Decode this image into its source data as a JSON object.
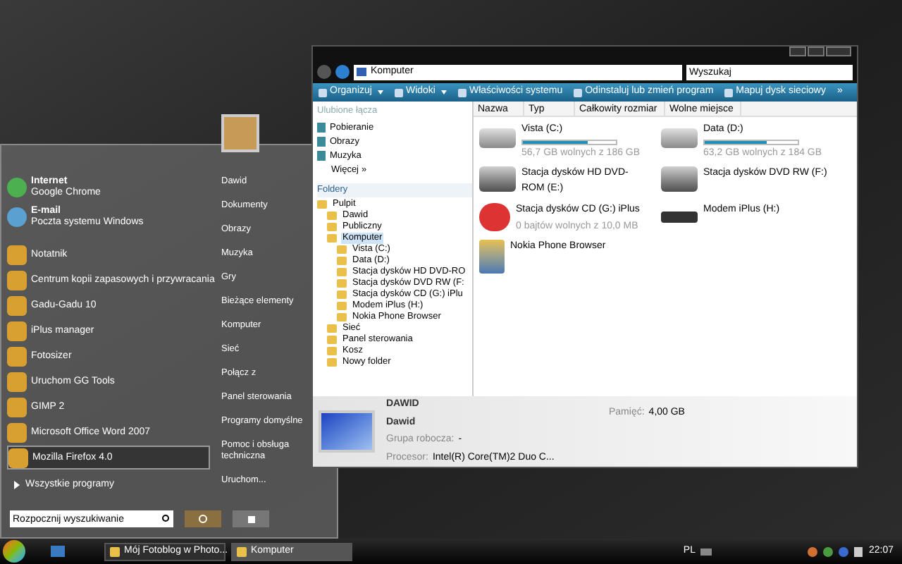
{
  "start_menu": {
    "pinned": [
      {
        "title": "Internet",
        "subtitle": "Google Chrome",
        "selected": false
      },
      {
        "title": "E-mail",
        "subtitle": "Poczta systemu Windows",
        "selected": false
      }
    ],
    "recent": [
      {
        "label": "Notatnik",
        "selected": false
      },
      {
        "label": "Centrum kopii zapasowych i przywracania",
        "selected": false
      },
      {
        "label": "Gadu-Gadu 10",
        "selected": false
      },
      {
        "label": "iPlus manager",
        "selected": false
      },
      {
        "label": "Fotosizer",
        "selected": false
      },
      {
        "label": "Uruchom GG Tools",
        "selected": false
      },
      {
        "label": "GIMP 2",
        "selected": false
      },
      {
        "label": "Microsoft Office Word 2007",
        "selected": false
      },
      {
        "label": "Mozilla Firefox 4.0",
        "selected": true
      }
    ],
    "all_programs": "Wszystkie programy",
    "search": {
      "placeholder": "Rozpocznij wyszukiwanie"
    },
    "places": [
      "Dawid",
      "Dokumenty",
      "Obrazy",
      "Muzyka",
      "Gry",
      "Bieżące elementy",
      "Komputer",
      "Sieć",
      "Połącz z",
      "Panel sterowania",
      "Programy domyślne",
      "Pomoc i obsługa techniczna",
      "Uruchom..."
    ]
  },
  "explorer": {
    "address": "Komputer",
    "search": {
      "placeholder": "Wyszukaj"
    },
    "toolbar": [
      {
        "label": "Organizuj",
        "dropdown": true
      },
      {
        "label": "Widoki",
        "dropdown": true
      },
      {
        "label": "Właściwości systemu",
        "dropdown": false
      },
      {
        "label": "Odinstaluj lub zmień program",
        "dropdown": false
      },
      {
        "label": "Mapuj dysk sieciowy",
        "dropdown": false
      }
    ],
    "toolbar_more": "»",
    "favorites_title": "Ulubione łącza",
    "favorites": [
      "Pobieranie",
      "Obrazy",
      "Muzyka"
    ],
    "favorites_more": "Więcej",
    "favorites_more_glyph": "»",
    "folders_title": "Foldery",
    "tree": [
      {
        "label": "Pulpit",
        "selected": false,
        "children": [
          {
            "label": "Dawid",
            "selected": false
          },
          {
            "label": "Publiczny",
            "selected": false
          },
          {
            "label": "Komputer",
            "selected": true,
            "children": [
              {
                "label": "Vista (C:)",
                "selected": false
              },
              {
                "label": "Data (D:)",
                "selected": false
              },
              {
                "label": "Stacja dysków HD DVD-RO",
                "selected": false
              },
              {
                "label": "Stacja dysków DVD RW (F:",
                "selected": false
              },
              {
                "label": "Stacja dysków CD (G:) iPlu",
                "selected": false
              },
              {
                "label": "Modem iPlus (H:)",
                "selected": false
              },
              {
                "label": "Nokia Phone Browser",
                "selected": false
              }
            ]
          },
          {
            "label": "Sieć",
            "selected": false
          },
          {
            "label": "Panel sterowania",
            "selected": false
          },
          {
            "label": "Kosz",
            "selected": false
          },
          {
            "label": "Nowy folder",
            "selected": false
          }
        ]
      }
    ],
    "columns": [
      "Nazwa",
      "Typ",
      "Całkowity rozmiar",
      "Wolne miejsce"
    ],
    "items": [
      {
        "kind": "disk",
        "name": "Vista (C:)",
        "level": 0.7,
        "free": "56,7 GB wolnych z 186 GB"
      },
      {
        "kind": "disk",
        "name": "Data (D:)",
        "level": 0.66,
        "free": "63,2 GB wolnych z 184 GB"
      },
      {
        "kind": "dvd",
        "name": "Stacja dysków HD DVD-ROM (E:)"
      },
      {
        "kind": "dvd",
        "name": "Stacja dysków DVD RW (F:)"
      },
      {
        "kind": "cd",
        "name": "Stacja dysków CD (G:) iPlus",
        "free": "0 bajtów wolnych z 10,0 MB"
      },
      {
        "kind": "modem",
        "name": "Modem iPlus (H:)"
      },
      {
        "kind": "app",
        "name": "Nokia Phone Browser"
      }
    ],
    "details": {
      "name": "DAWID",
      "user": "Dawid",
      "fields": [
        {
          "label": "Grupa robocza:",
          "value": "-"
        },
        {
          "label": "Procesor:",
          "value": "Intel(R) Core(TM)2 Duo C..."
        }
      ],
      "memory": {
        "label": "Pamięć:",
        "value": "4,00 GB"
      }
    }
  },
  "taskbar": {
    "tasks": [
      {
        "label": "Mój Fotoblog w Photo...",
        "selected": false
      },
      {
        "label": "Komputer",
        "selected": true
      }
    ],
    "language": "PL",
    "clock": "22:07"
  }
}
